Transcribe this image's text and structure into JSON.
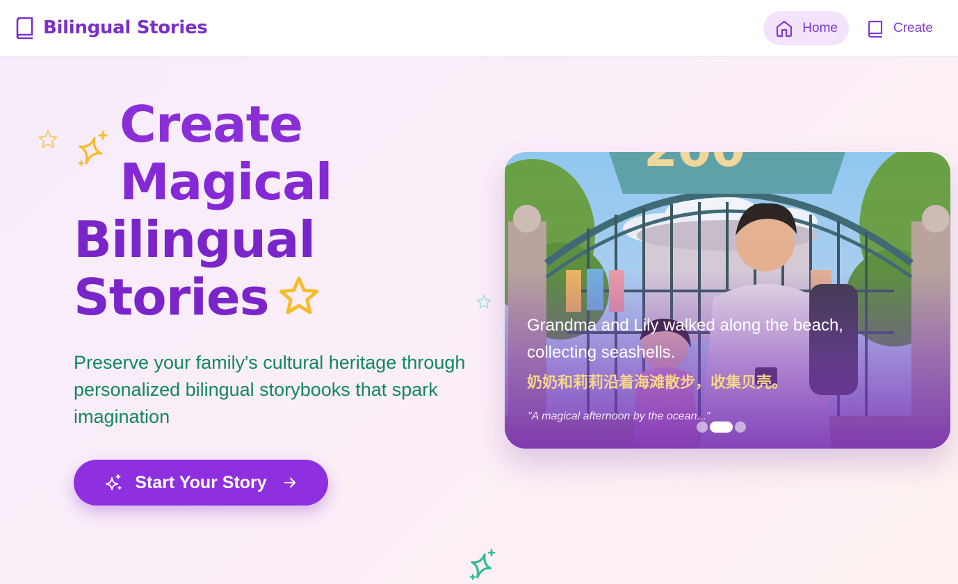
{
  "header": {
    "brand": "Bilingual Stories",
    "nav": [
      {
        "label": "Home",
        "icon": "home-icon",
        "active": true
      },
      {
        "label": "Create",
        "icon": "book-icon",
        "active": false
      }
    ]
  },
  "hero": {
    "title_lines": [
      "Create",
      "Magical",
      "Bilingual",
      "Stories"
    ],
    "subtitle": "Preserve your family's cultural heritage through personalized bilingual storybooks that spark imagination",
    "cta_label": "Start Your Story"
  },
  "carousel": {
    "caption_en": "Grandma and Lily walked along the beach, collecting seashells.",
    "caption_zh": "奶奶和莉莉沿着海滩散步，收集贝壳。",
    "quote": "\"A magical afternoon by the ocean...\"",
    "slide_count": 3,
    "active_slide": 2
  },
  "colors": {
    "brand_purple": "#7b2fc9",
    "title_purple": "#8a2be2",
    "subtitle_green": "#12875e",
    "cta_purple": "#8e2fe0",
    "star_yellow": "#f5bd2c",
    "star_teal": "#2fbf8f",
    "caption_gold": "#f6d68a"
  },
  "icons": {
    "brand": "book-icon",
    "cta_leading": "sparkles-icon",
    "cta_trailing": "arrow-right-icon",
    "decorations": [
      "star-icon",
      "sparkle-icon"
    ]
  }
}
